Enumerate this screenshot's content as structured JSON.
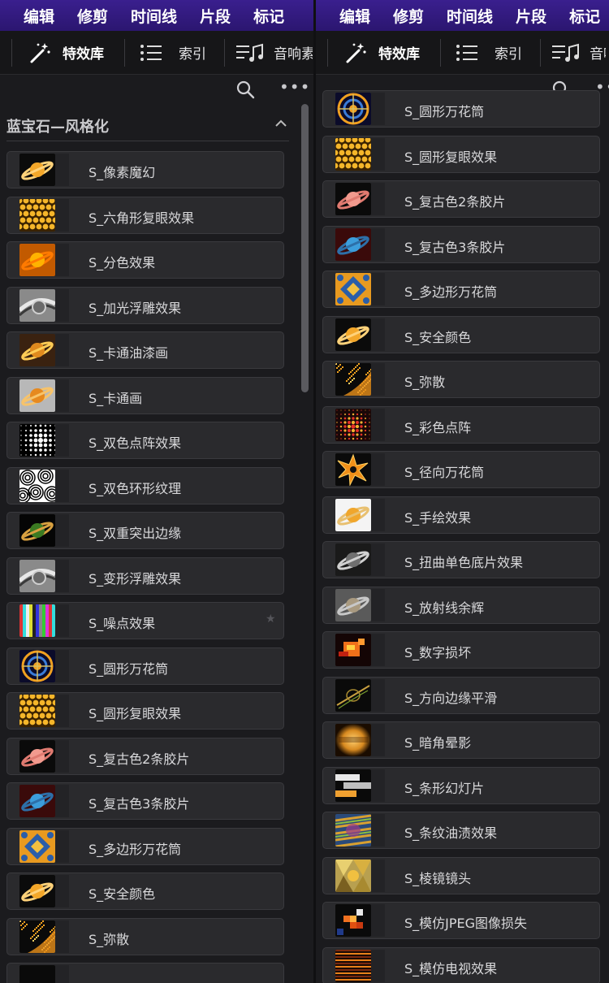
{
  "menu": {
    "items": [
      "编辑",
      "修剪",
      "时间线",
      "片段",
      "标记"
    ],
    "right_items": [
      "编辑",
      "修剪",
      "时间线",
      "片段",
      "标记"
    ]
  },
  "toolbar": {
    "effects_label": "特效库",
    "index_label": "索引",
    "sound_label": "音响素",
    "right_effects_label": "特效库",
    "right_index_label": "索引",
    "right_sound_label": "音响"
  },
  "search": {
    "more_label": "•••"
  },
  "category": {
    "title": "蓝宝石—风格化"
  },
  "left_list": [
    {
      "label": "S_像素魔幻",
      "thumb": "saturn-orange"
    },
    {
      "label": "S_六角形复眼效果",
      "thumb": "honeycomb"
    },
    {
      "label": "S_分色效果",
      "thumb": "saturn-posterize"
    },
    {
      "label": "S_加光浮雕效果",
      "thumb": "emboss-gray"
    },
    {
      "label": "S_卡通油漆画",
      "thumb": "saturn-cartoon"
    },
    {
      "label": "S_卡通画",
      "thumb": "saturn-cartoon2"
    },
    {
      "label": "S_双色点阵效果",
      "thumb": "halftone-bw"
    },
    {
      "label": "S_双色环形纹理",
      "thumb": "rings-bw"
    },
    {
      "label": "S_双重突出边缘",
      "thumb": "saturn-edge"
    },
    {
      "label": "S_变形浮雕效果",
      "thumb": "emboss-gray"
    },
    {
      "label": "S_噪点效果",
      "thumb": "noise",
      "star": "★"
    },
    {
      "label": "S_圆形万花筒",
      "thumb": "kaleido-round"
    },
    {
      "label": "S_圆形复眼效果",
      "thumb": "honeycomb"
    },
    {
      "label": "S_复古色2条胶片",
      "thumb": "saturn-pink"
    },
    {
      "label": "S_复古色3条胶片",
      "thumb": "saturn-blue"
    },
    {
      "label": "S_多边形万花筒",
      "thumb": "kaleido-poly"
    },
    {
      "label": "S_安全颜色",
      "thumb": "saturn-orange"
    },
    {
      "label": "S_弥散",
      "thumb": "diffuse"
    },
    {
      "label": "",
      "thumb": "partial"
    }
  ],
  "right_list": [
    {
      "label": "S_圆形万花筒",
      "thumb": "kaleido-round"
    },
    {
      "label": "S_圆形复眼效果",
      "thumb": "honeycomb"
    },
    {
      "label": "S_复古色2条胶片",
      "thumb": "saturn-pink"
    },
    {
      "label": "S_复古色3条胶片",
      "thumb": "saturn-blue"
    },
    {
      "label": "S_多边形万花筒",
      "thumb": "kaleido-poly"
    },
    {
      "label": "S_安全颜色",
      "thumb": "saturn-orange"
    },
    {
      "label": "S_弥散",
      "thumb": "diffuse"
    },
    {
      "label": "S_彩色点阵",
      "thumb": "color-dots"
    },
    {
      "label": "S_径向万花筒",
      "thumb": "star-burst"
    },
    {
      "label": "S_手绘效果",
      "thumb": "saturn-sketch"
    },
    {
      "label": "S_扭曲单色底片效果",
      "thumb": "saturn-mono"
    },
    {
      "label": "S_放射线余辉",
      "thumb": "saturn-gray"
    },
    {
      "label": "S_数字损坏",
      "thumb": "digital-damage"
    },
    {
      "label": "S_方向边缘平滑",
      "thumb": "edge-smooth"
    },
    {
      "label": "S_暗角晕影",
      "thumb": "vignette"
    },
    {
      "label": "S_条形幻灯片",
      "thumb": "bars-slide"
    },
    {
      "label": "S_条纹油渍效果",
      "thumb": "oil-stripes"
    },
    {
      "label": "S_棱镜镜头",
      "thumb": "prism"
    },
    {
      "label": "S_模仿JPEG图像损失",
      "thumb": "jpeg"
    },
    {
      "label": "S_模仿电视效果",
      "thumb": "tv"
    }
  ]
}
